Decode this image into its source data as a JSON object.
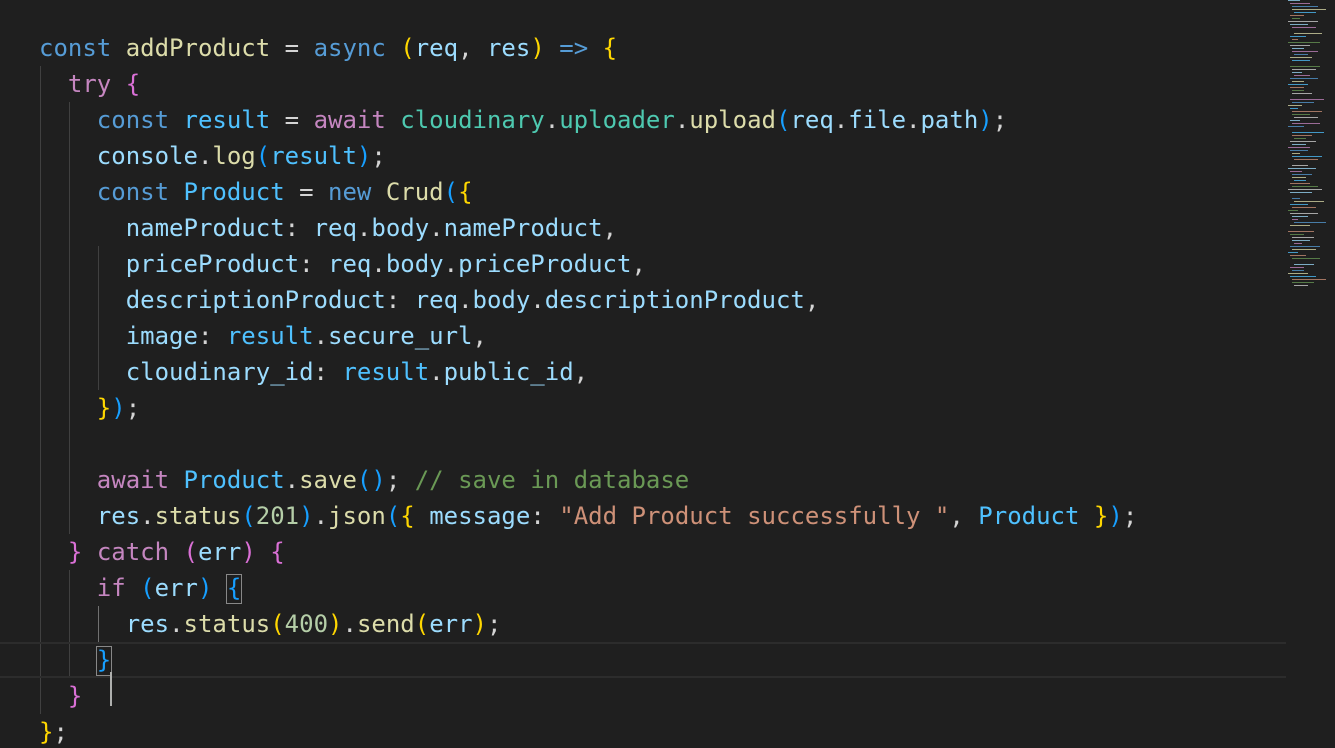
{
  "editor": {
    "theme_colors": {
      "background": "#1f1f1f",
      "keyword": "#569cd6",
      "control": "#c586c0",
      "function": "#dcdcaa",
      "variable": "#9cdcfe",
      "constant": "#4fc1ff",
      "class": "#4ec9b0",
      "number": "#b5cea8",
      "string": "#ce9178",
      "comment": "#6a9955",
      "bracket_level_1": "#ffd700",
      "bracket_level_2": "#da70d6",
      "bracket_level_3": "#179fff"
    },
    "language": "javascript",
    "lines": [
      "const addProduct = async (req, res) => {",
      "  try {",
      "    const result = await cloudinary.uploader.upload(req.file.path);",
      "    console.log(result);",
      "    const Product = new Crud({",
      "      nameProduct: req.body.nameProduct,",
      "      priceProduct: req.body.priceProduct,",
      "      descriptionProduct: req.body.descriptionProduct,",
      "      image: result.secure_url,",
      "      cloudinary_id: result.public_id,",
      "    });",
      "",
      "    await Product.save(); // save in database",
      "    res.status(201).json({ message: \"Add Product successfully \", Product });",
      "  } catch (err) {",
      "    if (err) {",
      "      res.status(400).send(err);",
      "    }",
      "  }",
      "};"
    ],
    "current_line": 18,
    "cursor_column": 5
  }
}
